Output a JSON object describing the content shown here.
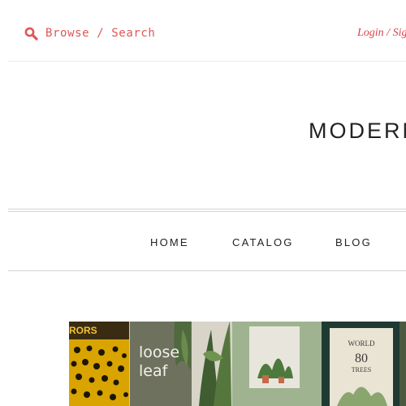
{
  "header": {
    "search_label": "Browse / Search",
    "search_icon": "search-icon",
    "login_label": "Login / Sign"
  },
  "site": {
    "title": "MODERN"
  },
  "nav": {
    "items": [
      {
        "label": "HOME"
      },
      {
        "label": "CATALOG"
      },
      {
        "label": "BLOG"
      }
    ]
  },
  "hero": {
    "books": [
      {
        "title_text": "RORS"
      },
      {
        "title_text": "loose leaf"
      },
      {
        "title_text": "WORLD 80 TREES"
      }
    ]
  },
  "colors": {
    "accent": "#e05555",
    "text": "#222222",
    "rule": "#d4d4d4"
  }
}
